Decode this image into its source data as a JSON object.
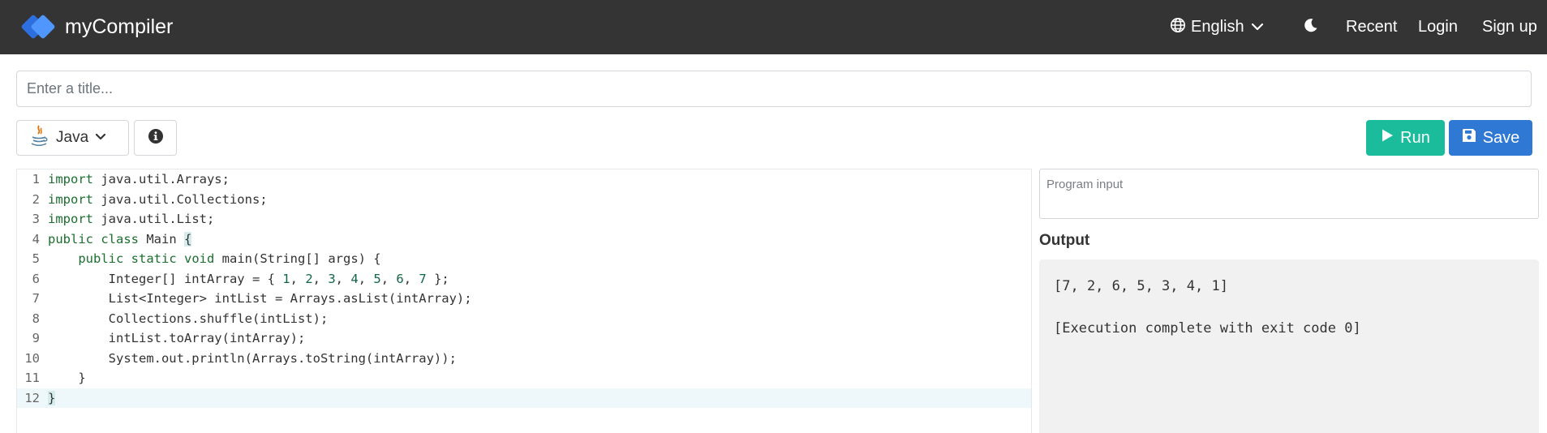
{
  "navbar": {
    "brand": "myCompiler",
    "language": "English",
    "links": {
      "recent": "Recent",
      "login": "Login",
      "signup": "Sign up"
    },
    "icons": {
      "logo": "mycompiler-logo",
      "globe": "globe-icon",
      "chevron": "chevron-down-icon",
      "theme": "moon-icon"
    }
  },
  "toolbar": {
    "title_placeholder": "Enter a title...",
    "language": "Java",
    "info_icon": "info-icon",
    "run_label": "Run",
    "save_label": "Save"
  },
  "colors": {
    "navbar": "#343434",
    "run": "#1abc9c",
    "save": "#2f78d3",
    "output_bg": "#f1f1f1"
  },
  "editor": {
    "active_line": 12,
    "lines": [
      {
        "n": "1",
        "text": "import java.util.Arrays;"
      },
      {
        "n": "2",
        "text": "import java.util.Collections;"
      },
      {
        "n": "3",
        "text": "import java.util.List;"
      },
      {
        "n": "4",
        "text": "public class Main {"
      },
      {
        "n": "5",
        "text": "    public static void main(String[] args) {"
      },
      {
        "n": "6",
        "text": "        Integer[] intArray = { 1, 2, 3, 4, 5, 6, 7 };"
      },
      {
        "n": "7",
        "text": "        List<Integer> intList = Arrays.asList(intArray);"
      },
      {
        "n": "8",
        "text": "        Collections.shuffle(intList);"
      },
      {
        "n": "9",
        "text": "        intList.toArray(intArray);"
      },
      {
        "n": "10",
        "text": "        System.out.println(Arrays.toString(intArray));"
      },
      {
        "n": "11",
        "text": "    }"
      },
      {
        "n": "12",
        "text": "}"
      }
    ]
  },
  "input_panel": {
    "placeholder": "Program input"
  },
  "output": {
    "label": "Output",
    "text": "[7, 2, 6, 5, 3, 4, 1]\n\n[Execution complete with exit code 0]"
  }
}
